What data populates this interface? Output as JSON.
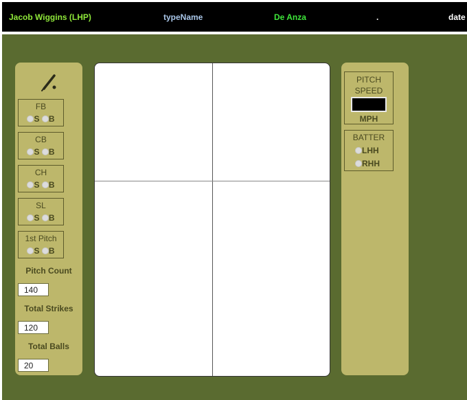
{
  "header": {
    "pitcher": "Jacob Wiggins (LHP)",
    "type_name": "typeName",
    "team": "De Anza",
    "separator": ".",
    "date": "date"
  },
  "pitch_types": [
    {
      "label": "FB",
      "opt_strike": "S",
      "opt_ball": "B"
    },
    {
      "label": "CB",
      "opt_strike": "S",
      "opt_ball": "B"
    },
    {
      "label": "CH",
      "opt_strike": "S",
      "opt_ball": "B"
    },
    {
      "label": "SL",
      "opt_strike": "S",
      "opt_ball": "B"
    },
    {
      "label": "1st Pitch",
      "opt_strike": "S",
      "opt_ball": "B"
    }
  ],
  "stats": {
    "pitch_count_label": "Pitch Count",
    "pitch_count": "140",
    "total_strikes_label": "Total Strikes",
    "total_strikes": "120",
    "total_balls_label": "Total Balls",
    "total_balls": "20"
  },
  "speed": {
    "label_line1": "PITCH",
    "label_line2": "SPEED",
    "unit": "MPH",
    "value": ""
  },
  "batter": {
    "label": "BATTER",
    "lhh": "LHH",
    "rhh": "RHH"
  },
  "icons": {
    "bat": "baseball-bat-icon"
  },
  "colors": {
    "header_bg": "#000000",
    "field_bg": "#5a6b30",
    "panel_bg": "#bdb76b",
    "pitcher_text": "#8fe83a",
    "team_text": "#3ee63a",
    "typename_text": "#a9c6e8"
  }
}
